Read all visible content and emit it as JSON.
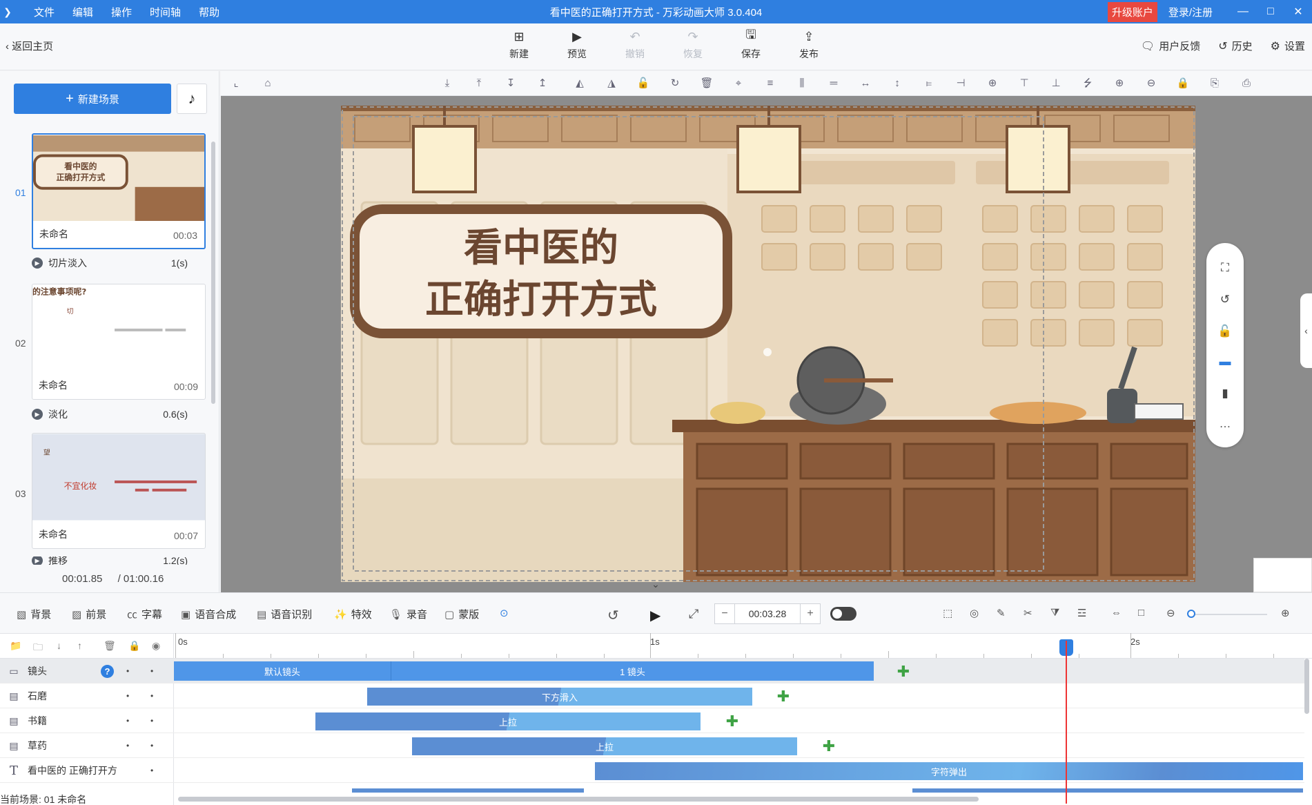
{
  "app": {
    "title": "看中医的正确打开方式 - 万彩动画大师 3.0.404",
    "menu": [
      "文件",
      "编辑",
      "操作",
      "时间轴",
      "帮助"
    ],
    "upgrade_label": "升级账户",
    "login_label": "登录/注册",
    "accent_color": "#2f7fe0"
  },
  "toolbar": {
    "back_label": "返回主页",
    "tools": [
      {
        "label": "新建",
        "icon": "plus-square-icon",
        "enabled": true
      },
      {
        "label": "预览",
        "icon": "play-icon",
        "enabled": true
      },
      {
        "label": "撤销",
        "icon": "undo-icon",
        "enabled": false
      },
      {
        "label": "恢复",
        "icon": "redo-icon",
        "enabled": false
      },
      {
        "label": "保存",
        "icon": "save-icon",
        "enabled": true
      },
      {
        "label": "发布",
        "icon": "publish-icon",
        "enabled": true
      }
    ],
    "right": [
      {
        "label": "用户反馈",
        "icon": "feedback-icon"
      },
      {
        "label": "历史",
        "icon": "history-icon"
      },
      {
        "label": "设置",
        "icon": "gear-icon"
      }
    ]
  },
  "scenes_panel": {
    "new_scene_label": "新建场景",
    "scenes": [
      {
        "num": "01",
        "name": "未命名",
        "duration": "00:03",
        "thumb_text": "看中医的\n正确打开方式",
        "active": true
      },
      {
        "num": "02",
        "name": "未命名",
        "duration": "00:09",
        "thumb_text": "的注意事项呢?",
        "active": false
      },
      {
        "num": "03",
        "name": "未命名",
        "duration": "00:07",
        "thumb_text": "不宜化妆",
        "active": false
      }
    ],
    "transitions": [
      {
        "name": "切片淡入",
        "value": "1(s)"
      },
      {
        "name": "淡化",
        "value": "0.6(s)"
      },
      {
        "name": "推移",
        "value": "1.2(s)"
      }
    ],
    "current_time": "00:01.85",
    "total_time": "/ 01:00.16"
  },
  "stage": {
    "title_line1": "看中医的",
    "title_line2": "正确打开方式"
  },
  "bottom_toolbar": {
    "items": [
      {
        "label": "背景",
        "icon": "background-icon"
      },
      {
        "label": "前景",
        "icon": "foreground-icon"
      },
      {
        "label": "字幕",
        "icon": "subtitle-icon"
      },
      {
        "label": "语音合成",
        "icon": "tts-icon"
      },
      {
        "label": "语音识别",
        "icon": "speech-recognition-icon"
      },
      {
        "label": "特效",
        "icon": "effects-icon"
      },
      {
        "label": "录音",
        "icon": "microphone-icon"
      },
      {
        "label": "蒙版",
        "icon": "mask-icon"
      }
    ],
    "time_value": "00:03.28"
  },
  "timeline": {
    "ruler_labels": [
      "0s",
      "1s",
      "2s"
    ],
    "tracks": [
      {
        "name": "镜头",
        "icon": "camera-icon",
        "clips": [
          "默认镜头",
          "1 镜头"
        ]
      },
      {
        "name": "石磨",
        "icon": "element-icon",
        "clips": [
          "下方滑入"
        ]
      },
      {
        "name": "书籍",
        "icon": "element-icon",
        "clips": [
          "上拉"
        ]
      },
      {
        "name": "草药",
        "icon": "element-icon",
        "clips": [
          "上拉"
        ]
      },
      {
        "name": "看中医的 正确打开方",
        "icon": "text-icon",
        "clips": [
          "字符弹出"
        ]
      }
    ],
    "status": "当前场景: 01   未命名"
  }
}
